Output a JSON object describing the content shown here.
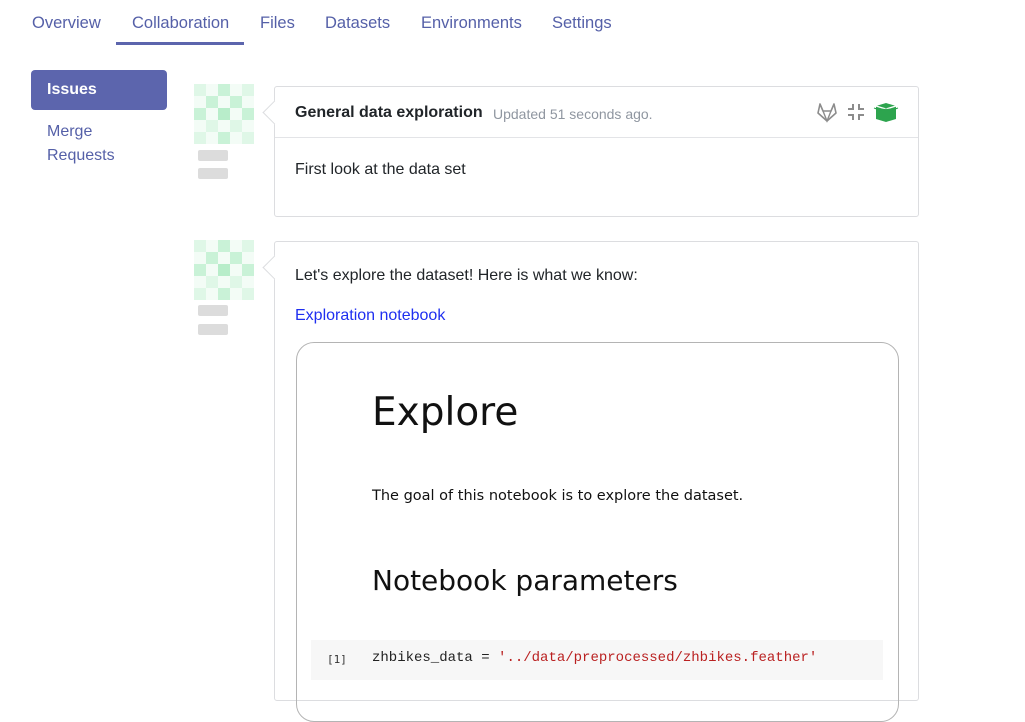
{
  "tabs": [
    {
      "label": "Overview"
    },
    {
      "label": "Collaboration",
      "active": true
    },
    {
      "label": "Files"
    },
    {
      "label": "Datasets"
    },
    {
      "label": "Environments"
    },
    {
      "label": "Settings"
    }
  ],
  "sidebar": {
    "items": [
      {
        "label": "Issues",
        "active": true
      },
      {
        "label": "Merge Requests"
      }
    ]
  },
  "issue": {
    "title": "General data exploration",
    "updated": "Updated 51 seconds ago.",
    "description": "First look at the data set",
    "icons": [
      "gitlab-icon",
      "collapse-icon",
      "package-icon"
    ]
  },
  "comment": {
    "text": "Let's explore the dataset! Here is what we know:",
    "link_label": "Exploration notebook"
  },
  "notebook": {
    "heading": "Explore",
    "paragraph": "The goal of this notebook is to explore the dataset.",
    "subheading": "Notebook parameters",
    "cell_prompt": "[1]",
    "code_var": "zhbikes_data",
    "code_op": " = ",
    "code_str": "'../data/preprocessed/zhbikes.feather'"
  },
  "colors": {
    "accent": "#5c65ad",
    "link": "#1f2ff0",
    "success": "#2da44e",
    "muted": "#8f96a0"
  }
}
